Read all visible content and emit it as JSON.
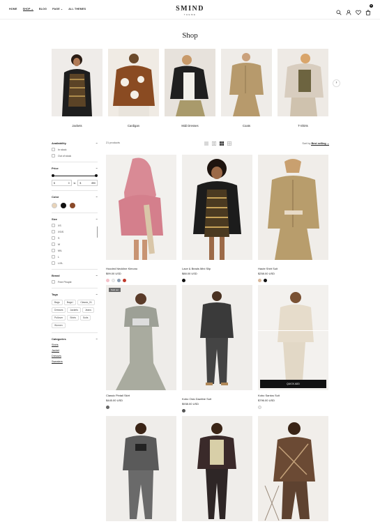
{
  "header": {
    "nav": [
      "HOME",
      "SHOP",
      "BLOG",
      "PAGE",
      "ALL THEMES"
    ],
    "logo": "SMIND",
    "logo_sub": "THEME",
    "cart_count": "0"
  },
  "page_title": "Shop",
  "categories": [
    "Jackets",
    "Cardigan",
    "Midi Dresses",
    "Coats",
    "T-Shirts"
  ],
  "filters": {
    "availability": {
      "title": "Availability",
      "options": [
        "In stock",
        "Out of stock"
      ]
    },
    "price": {
      "title": "Price",
      "min_symbol": "$",
      "min": "0",
      "to": "to",
      "max_symbol": "$",
      "max": "890"
    },
    "color": {
      "title": "Color",
      "swatches": [
        "#e8d3b8",
        "#111111",
        "#8b4a2a"
      ]
    },
    "size": {
      "title": "Size",
      "options": [
        "XS",
        "XS/S",
        "S",
        "M",
        "M/L",
        "L",
        "L/XL"
      ]
    },
    "brand": {
      "title": "Brand",
      "options": [
        "Free People"
      ]
    },
    "tags": {
      "title": "Tags",
      "items": [
        "Bags",
        "Bags I",
        "Classic_01",
        "Dresses",
        "Jackets",
        "Jeans",
        "Pullover",
        "Shirts",
        "Suits",
        "Women"
      ]
    },
    "categories": {
      "title": "Categories",
      "items": [
        "Shirts",
        "Jacket",
        "Dresses",
        "Sweaters"
      ]
    }
  },
  "toolbar": {
    "count": "21 products",
    "sort_label": "Sort by",
    "sort_value": "Best selling"
  },
  "products": [
    {
      "name": "Hooded Neckline Kimono",
      "price": "$99.00 USD",
      "swatches": [
        "#f4c1c9",
        "#eeeeee",
        "#8ea0b5",
        "#c0392b"
      ]
    },
    {
      "name": "Lace & Beads Mini Slip",
      "price": "$88.00 USD",
      "swatches": [
        "#111111"
      ]
    },
    {
      "name": "Haute Shirt Suit",
      "price": "$258.00 USD",
      "swatches": [
        "#d8b89a",
        "#111111"
      ]
    },
    {
      "name": "Classic Pintail Skirt",
      "price": "$445.00 USD",
      "badge": "Sold out",
      "swatches": [
        "#666666"
      ]
    },
    {
      "name": "Kobo Oslo Dawline Suit",
      "price": "$938.00 USD",
      "swatches": [
        "#555555"
      ]
    },
    {
      "name": "Kobo Santos Suit",
      "price": "$796.00 USD",
      "quick_add": "QUICK ADD",
      "swatches": [
        "#eeeeee"
      ]
    },
    {
      "name": "",
      "price": "",
      "swatches": []
    },
    {
      "name": "",
      "price": "",
      "swatches": []
    },
    {
      "name": "",
      "price": "",
      "swatches": []
    }
  ],
  "colors": {
    "accent": "#111111",
    "border": "#e5e5e5"
  }
}
